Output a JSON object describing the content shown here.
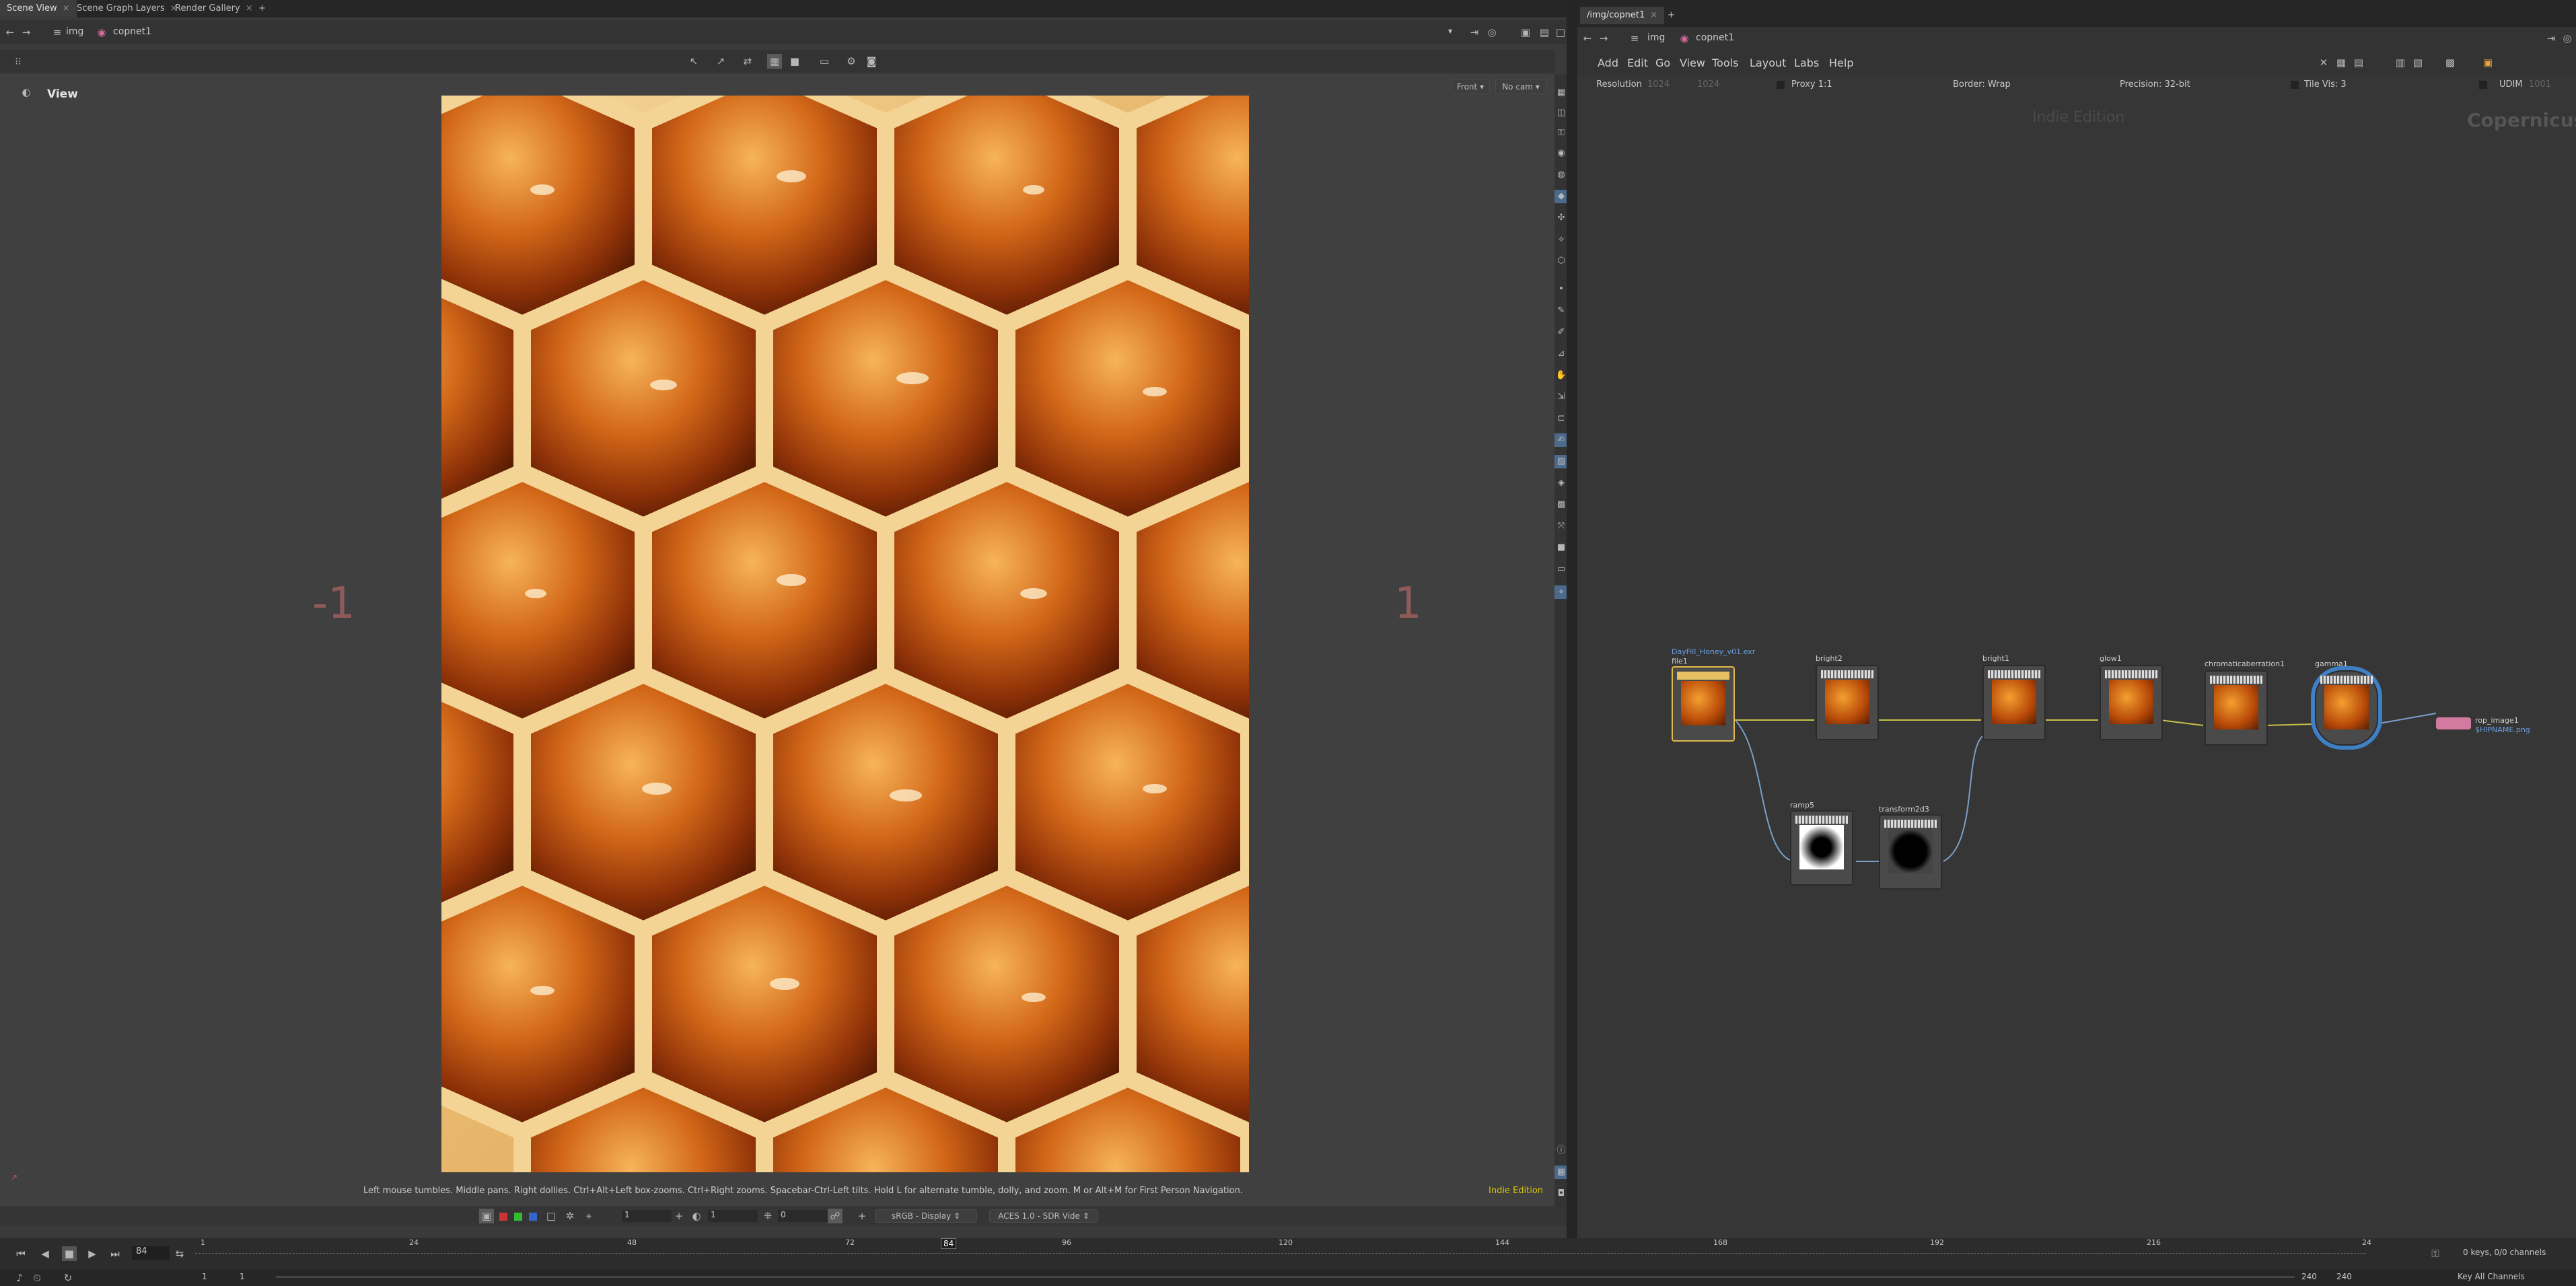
{
  "left_tabs": [
    "Scene View",
    "Scene Graph Layers",
    "Render Gallery"
  ],
  "right_tabs": [
    "/img/copnet1"
  ],
  "left_path": {
    "root": "img",
    "net": "copnet1"
  },
  "right_path": {
    "root": "img",
    "net": "copnet1"
  },
  "viewer": {
    "label": "View",
    "cam_front": "Front",
    "cam_nocam": "No cam",
    "left_marker": "-1",
    "right_marker": "1",
    "hint": "Left mouse tumbles. Middle pans. Right dollies. Ctrl+Alt+Left box-zooms. Ctrl+Right zooms. Spacebar-Ctrl-Left tilts. Hold L for alternate tumble, dolly, and zoom. M or Alt+M for First Person Navigation.",
    "edition": "Indie Edition"
  },
  "display_bar": {
    "field1": "1",
    "field2": "1",
    "field3": "0",
    "colorspace": "sRGB - Display",
    "view_transform": "ACES 1.0 - SDR Vide"
  },
  "network_menu": [
    "Add",
    "Edit",
    "Go",
    "View",
    "Tools",
    "Layout",
    "Labs",
    "Help"
  ],
  "network_props": {
    "resolution_label": "Resolution",
    "res_w": "1024",
    "res_h": "1024",
    "proxy": "Proxy 1:1",
    "border": "Border: Wrap",
    "precision": "Precision: 32-bit",
    "tile_vis": "Tile Vis: 3",
    "udim": "UDIM",
    "udim_val": "1001"
  },
  "network_watermarks": {
    "edition": "Indie Edition",
    "context": "Copernicus"
  },
  "nodes": [
    {
      "name": "file1",
      "sub": "DayFill_Honey_v01.exr"
    },
    {
      "name": "bright2",
      "sub": ""
    },
    {
      "name": "bright1",
      "sub": ""
    },
    {
      "name": "glow1",
      "sub": ""
    },
    {
      "name": "chromaticaberration1",
      "sub": ""
    },
    {
      "name": "gamma1",
      "sub": ""
    },
    {
      "name": "rop_image1",
      "sub": "$HIPNAME.png"
    },
    {
      "name": "ramp5",
      "sub": ""
    },
    {
      "name": "transform2d3",
      "sub": ""
    }
  ],
  "timeline": {
    "frame": "84",
    "ticks": [
      "1",
      "24",
      "48",
      "72",
      "84",
      "96",
      "120",
      "144",
      "168",
      "192",
      "216",
      "24"
    ],
    "start_a": "1",
    "start_b": "1",
    "end_a": "240",
    "end_b": "240",
    "keys_info": "0 keys, 0/0 channels",
    "key_all": "Key All Channels"
  }
}
